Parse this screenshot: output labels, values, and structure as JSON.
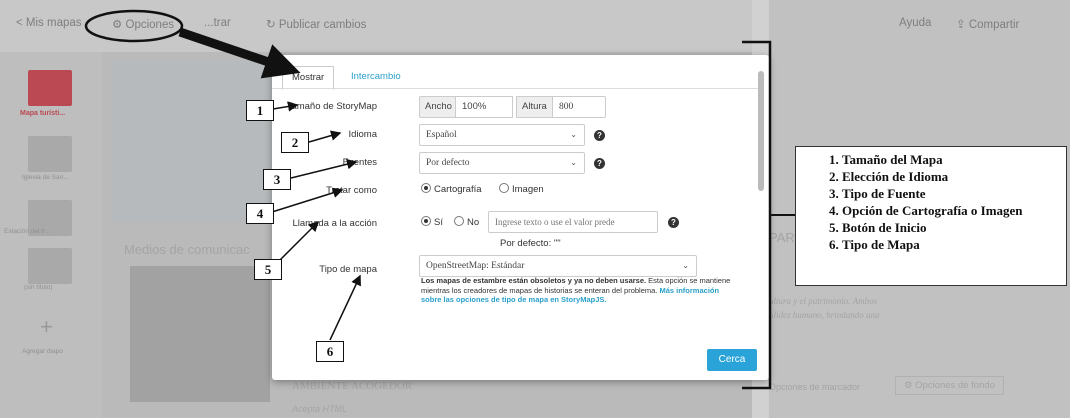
{
  "topbar": {
    "back_label": "< Mis mapas",
    "options_label": "Opciones",
    "preview_label": "...trar",
    "publish_label": "Publicar cambios",
    "help_label": "Ayuda",
    "share_label": "Compartir"
  },
  "sidebar": {
    "slides": [
      {
        "label": "Mapa turísti..."
      },
      {
        "label": "Iglesia de San..."
      },
      {
        "label": "Estación del tr..."
      },
      {
        "label": "(sin título)"
      }
    ],
    "add_label": "Agregar diapo"
  },
  "background": {
    "media_title": "Medios de comunicac",
    "right_title": "PARR",
    "right_text1": "ultura y el patrimonio. Ambos",
    "right_text2": "alidez humano, brindando una",
    "bottom_text": "AMBIENTE ACOGEDOR",
    "bottom_sub": "Acepta HTML",
    "marker_options": "Opciones de marcador",
    "background_options": "Opciones de fondo"
  },
  "modal": {
    "tabs": [
      "Mostrar",
      "Intercambio"
    ],
    "size": {
      "label": "Tamaño de StoryMap",
      "width_label": "Ancho",
      "width_value": "100%",
      "height_label": "Altura",
      "height_value": "800"
    },
    "language": {
      "label": "Idioma",
      "value": "Español"
    },
    "fonts": {
      "label": "Fuentes",
      "value": "Por defecto"
    },
    "treat_as": {
      "label": "Tratar como",
      "options": [
        "Cartografía",
        "Imagen"
      ],
      "selected": "Cartografía"
    },
    "call_to_action": {
      "label": "Llamada a la acción",
      "options": [
        "Sí",
        "No"
      ],
      "selected": "Sí",
      "placeholder": "Ingrese texto o use el valor prede",
      "default_text": "Por defecto: \"\""
    },
    "map_type": {
      "label": "Tipo de mapa",
      "value": "OpenStreetMap: Estándar",
      "note_bold": "Los mapas de estambre están obsoletos y ya no deben usarse.",
      "note_text": " Esta opción se mantiene mientras los creadores de mapas de historias se enteran del problema. ",
      "note_link": "Más información sobre las opciones de tipo de mapa en StoryMapJS."
    },
    "close_label": "Cerca"
  },
  "annotations": {
    "numbers": [
      "1",
      "2",
      "3",
      "4",
      "5",
      "6"
    ],
    "legend": [
      "Tamaño del Mapa",
      "Elección de Idioma",
      "Tipo de Fuente",
      "Opción de Cartografía o Imagen",
      "Botón de Inicio",
      "Tipo de Mapa"
    ]
  }
}
